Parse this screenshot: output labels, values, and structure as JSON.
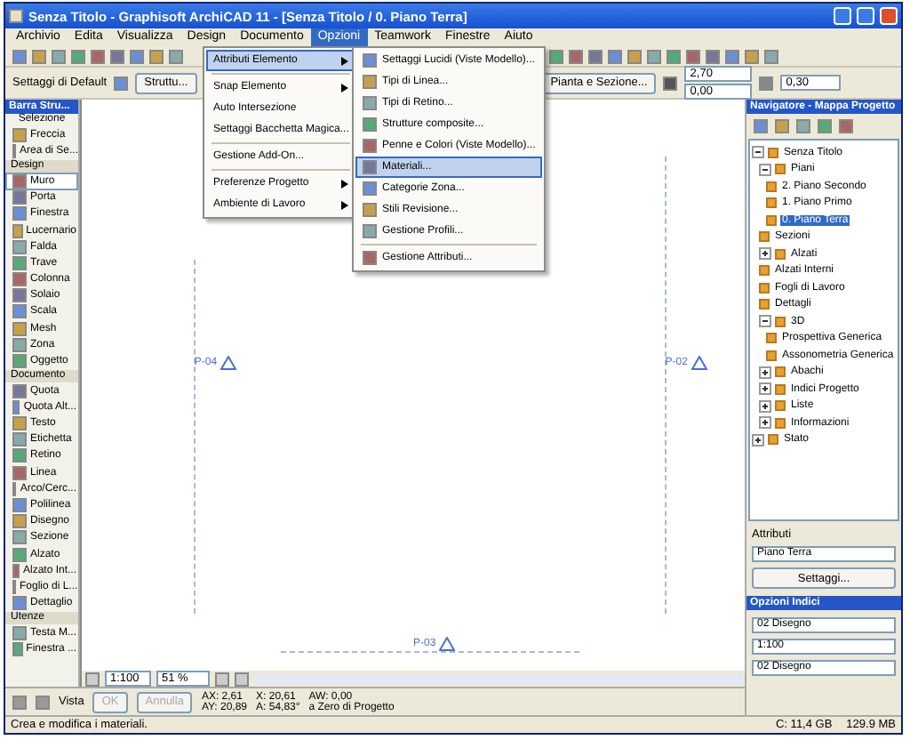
{
  "window": {
    "title": "Senza Titolo - Graphisoft ArchiCAD 11 - [Senza Titolo / 0. Piano Terra]"
  },
  "menubar": [
    {
      "label": "Archivio",
      "selected": false
    },
    {
      "label": "Edita",
      "selected": false
    },
    {
      "label": "Visualizza",
      "selected": false
    },
    {
      "label": "Design",
      "selected": false
    },
    {
      "label": "Documento",
      "selected": false
    },
    {
      "label": "Opzioni",
      "selected": true
    },
    {
      "label": "Teamwork",
      "selected": false
    },
    {
      "label": "Finestre",
      "selected": false
    },
    {
      "label": "Aiuto",
      "selected": false
    }
  ],
  "options_menu": [
    {
      "kind": "item",
      "label": "Attributi Elemento",
      "submenu": true,
      "selected": true
    },
    {
      "kind": "separator"
    },
    {
      "kind": "item",
      "label": "Snap Elemento",
      "submenu": true,
      "selected": false
    },
    {
      "kind": "item",
      "label": "Auto Intersezione",
      "submenu": false,
      "selected": false
    },
    {
      "kind": "item",
      "label": "Settaggi Bacchetta Magica...",
      "submenu": false,
      "selected": false
    },
    {
      "kind": "separator"
    },
    {
      "kind": "item",
      "label": "Gestione Add-On...",
      "submenu": false,
      "selected": false
    },
    {
      "kind": "separator"
    },
    {
      "kind": "item",
      "label": "Preferenze Progetto",
      "submenu": true,
      "selected": false
    },
    {
      "kind": "item",
      "label": "Ambiente di Lavoro",
      "submenu": true,
      "selected": false
    }
  ],
  "attributes_submenu": [
    {
      "kind": "item",
      "label": "Settaggi Lucidi (Viste Modello)...",
      "selected": false
    },
    {
      "kind": "item",
      "label": "Tipi di Linea...",
      "selected": false
    },
    {
      "kind": "item",
      "label": "Tipi di Retino...",
      "selected": false
    },
    {
      "kind": "item",
      "label": "Strutture composite...",
      "selected": false
    },
    {
      "kind": "item",
      "label": "Penne e Colori (Viste Modello)...",
      "selected": false
    },
    {
      "kind": "item",
      "label": "Materiali...",
      "selected": true
    },
    {
      "kind": "item",
      "label": "Categorie Zona...",
      "selected": false
    },
    {
      "kind": "item",
      "label": "Stili Revisione...",
      "selected": false
    },
    {
      "kind": "item",
      "label": "Gestione Profili...",
      "selected": false
    },
    {
      "kind": "separator"
    },
    {
      "kind": "item",
      "label": "Gestione Attributi...",
      "selected": false
    }
  ],
  "info_box": {
    "label": "Settaggi di Default",
    "structure_button": "Struttu...",
    "view_button": "Pianta e Sezione...",
    "field_1": "2,70",
    "field_2": "0,00",
    "field_3": "0,30"
  },
  "toolbox": {
    "title": "Barra Stru...",
    "items": [
      {
        "kind": "header",
        "label": "Selezione"
      },
      {
        "kind": "tool",
        "label": "Freccia",
        "selected": false
      },
      {
        "kind": "tool",
        "label": "Area di Se...",
        "selected": false
      },
      {
        "kind": "group",
        "label": "Design"
      },
      {
        "kind": "tool",
        "label": "Muro",
        "selected": true
      },
      {
        "kind": "tool",
        "label": "Porta",
        "selected": false
      },
      {
        "kind": "tool",
        "label": "Finestra",
        "selected": false
      },
      {
        "kind": "tool",
        "label": "Lucernario",
        "selected": false
      },
      {
        "kind": "tool",
        "label": "Falda",
        "selected": false
      },
      {
        "kind": "tool",
        "label": "Trave",
        "selected": false
      },
      {
        "kind": "tool",
        "label": "Colonna",
        "selected": false
      },
      {
        "kind": "tool",
        "label": "Solaio",
        "selected": false
      },
      {
        "kind": "tool",
        "label": "Scala",
        "selected": false
      },
      {
        "kind": "tool",
        "label": "Mesh",
        "selected": false
      },
      {
        "kind": "tool",
        "label": "Zona",
        "selected": false
      },
      {
        "kind": "tool",
        "label": "Oggetto",
        "selected": false
      },
      {
        "kind": "group",
        "label": "Documento"
      },
      {
        "kind": "tool",
        "label": "Quota",
        "selected": false
      },
      {
        "kind": "tool",
        "label": "Quota Alt...",
        "selected": false
      },
      {
        "kind": "tool",
        "label": "Testo",
        "selected": false
      },
      {
        "kind": "tool",
        "label": "Etichetta",
        "selected": false
      },
      {
        "kind": "tool",
        "label": "Retino",
        "selected": false
      },
      {
        "kind": "tool",
        "label": "Linea",
        "selected": false
      },
      {
        "kind": "tool",
        "label": "Arco/Cerc...",
        "selected": false
      },
      {
        "kind": "tool",
        "label": "Polilinea",
        "selected": false
      },
      {
        "kind": "tool",
        "label": "Disegno",
        "selected": false
      },
      {
        "kind": "tool",
        "label": "Sezione",
        "selected": false
      },
      {
        "kind": "tool",
        "label": "Alzato",
        "selected": false
      },
      {
        "kind": "tool",
        "label": "Alzato Int...",
        "selected": false
      },
      {
        "kind": "tool",
        "label": "Foglio di L...",
        "selected": false
      },
      {
        "kind": "tool",
        "label": "Dettaglio",
        "selected": false
      },
      {
        "kind": "group",
        "label": "Utenze"
      },
      {
        "kind": "tool",
        "label": "Testa M...",
        "selected": false
      },
      {
        "kind": "tool",
        "label": "Finestra ...",
        "selected": false
      }
    ]
  },
  "canvas": {
    "markers": [
      {
        "label": "P-04"
      },
      {
        "label": "P-02"
      },
      {
        "label": "P-03"
      }
    ],
    "scale": "1:100",
    "zoom": "51 %"
  },
  "navigator": {
    "title": "Navigatore - Mappa Progetto",
    "tree": [
      {
        "label": "Senza Titolo",
        "expanded": true,
        "selected": false,
        "children": [
          {
            "label": "Piani",
            "expanded": true,
            "selected": false,
            "children": [
              {
                "label": "2. Piano Secondo",
                "selected": false
              },
              {
                "label": "1. Piano Primo",
                "selected": false
              },
              {
                "label": "0. Piano Terra",
                "selected": true
              }
            ]
          },
          {
            "label": "Sezioni",
            "selected": false
          },
          {
            "label": "Alzati",
            "expanded": false,
            "selected": false
          },
          {
            "label": "Alzati Interni",
            "selected": false
          },
          {
            "label": "Fogli di Lavoro",
            "selected": false
          },
          {
            "label": "Dettagli",
            "selected": false
          },
          {
            "label": "3D",
            "expanded": true,
            "selected": false,
            "children": [
              {
                "label": "Prospettiva Generica",
                "selected": false
              },
              {
                "label": "Assonometria Generica",
                "selected": false
              }
            ]
          },
          {
            "label": "Abachi",
            "expanded": false,
            "selected": false
          },
          {
            "label": "Indici Progetto",
            "expanded": false,
            "selected": false
          },
          {
            "label": "Liste",
            "expanded": false,
            "selected": false
          },
          {
            "label": "Informazioni",
            "expanded": false,
            "selected": false
          }
        ]
      },
      {
        "label": "Stato",
        "expanded": false,
        "selected": false
      }
    ],
    "attributes_title": "Attributi",
    "story_field": "Piano Terra",
    "settings_button": "Settaggi...",
    "options_title": "Opzioni Indici",
    "dropdowns": [
      "02 Disegno",
      "1:100",
      "02 Disegno"
    ]
  },
  "control_bar": {
    "label": "Vista",
    "ok_button": "OK",
    "cancel_button": "Annulla",
    "dx": "AX: 2,61",
    "dy": "AY: 20,89",
    "x": "X: 20,61",
    "angle": "A: 54,83°",
    "dw": "AW: 0,00",
    "origin": "a Zero di Progetto"
  },
  "status_bar": {
    "message": "Crea e modifica i materiali.",
    "disk": "C: 11,4 GB",
    "memory": "129.9 MB"
  }
}
